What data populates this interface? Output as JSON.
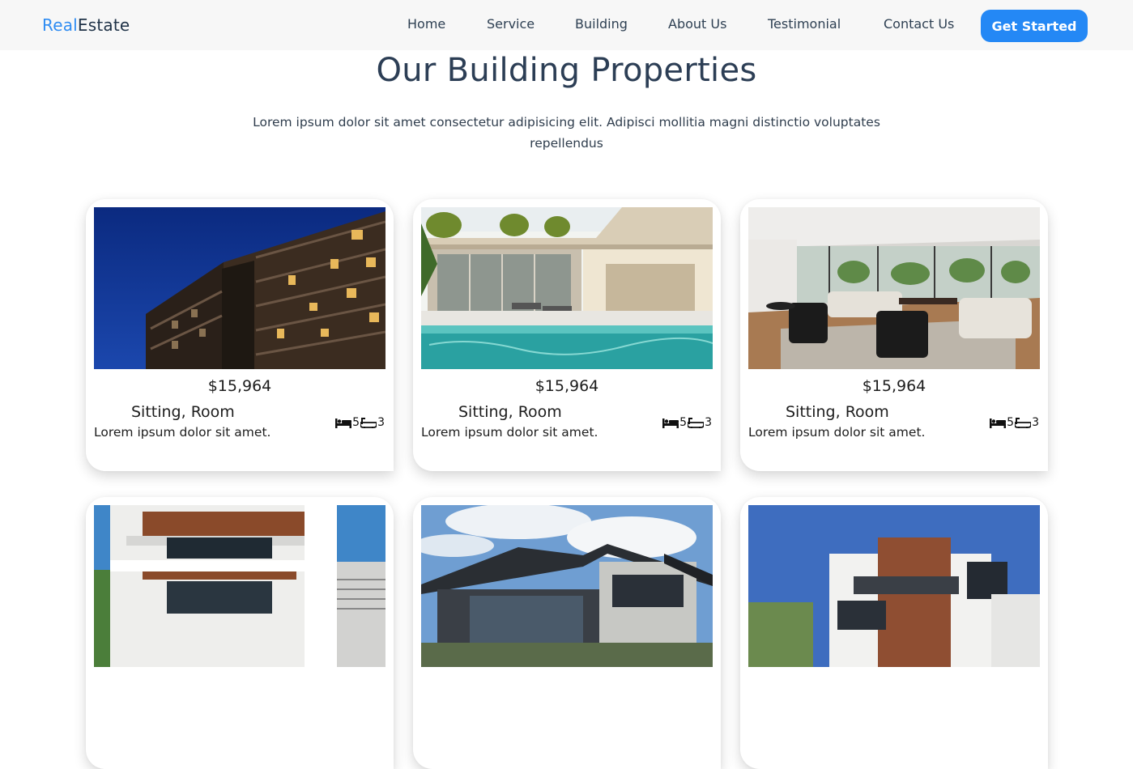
{
  "header": {
    "logo_part1": "Real",
    "logo_part2": "Estate",
    "nav": [
      "Home",
      "Service",
      "Building",
      "About Us",
      "Testimonial",
      "Contact Us"
    ],
    "cta": "Get Started",
    "colors": {
      "brand": "#2f8cf2",
      "cta": "#2488f5"
    }
  },
  "section": {
    "title": "Our Building Properties",
    "subtitle": "Lorem ipsum dolor sit amet consectetur adipisicing elit. Adipisci mollitia magni distinctio voluptates repellendus"
  },
  "properties": [
    {
      "image": "apartment-building-night",
      "price": "$15,964",
      "title": "Sitting, Room",
      "desc": "Lorem ipsum dolor sit amet.",
      "beds": "5",
      "baths": "3"
    },
    {
      "image": "villa-pool",
      "price": "$15,964",
      "title": "Sitting, Room",
      "desc": "Lorem ipsum dolor sit amet.",
      "beds": "5",
      "baths": "3"
    },
    {
      "image": "living-room-interior",
      "price": "$15,964",
      "title": "Sitting, Room",
      "desc": "Lorem ipsum dolor sit amet.",
      "beds": "5",
      "baths": "3"
    },
    {
      "image": "white-modern-house",
      "price": "",
      "title": "",
      "desc": "",
      "beds": "",
      "baths": ""
    },
    {
      "image": "dark-modern-house",
      "price": "",
      "title": "",
      "desc": "",
      "beds": "",
      "baths": ""
    },
    {
      "image": "wood-panel-house",
      "price": "",
      "title": "",
      "desc": "",
      "beds": "",
      "baths": ""
    }
  ],
  "icons": {
    "bed": "bed-icon",
    "bath": "bath-icon"
  }
}
